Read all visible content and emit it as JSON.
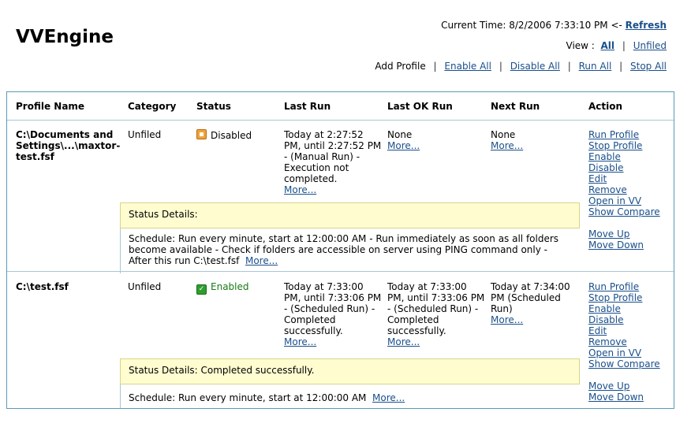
{
  "app": {
    "title": "VVEngine"
  },
  "header": {
    "current_time_label": "Current Time: 8/2/2006 7:33:10 PM <-",
    "refresh": "Refresh",
    "view_label": "View :",
    "view_all": "All",
    "view_unfiled": "Unfiled",
    "actions": {
      "add_profile": "Add Profile",
      "enable_all": "Enable All",
      "disable_all": "Disable All",
      "run_all": "Run All",
      "stop_all": "Stop All"
    }
  },
  "table": {
    "columns": {
      "profile_name": "Profile Name",
      "category": "Category",
      "status": "Status",
      "last_run": "Last Run",
      "last_ok_run": "Last OK Run",
      "next_run": "Next Run",
      "action": "Action"
    },
    "action_links": {
      "run": "Run Profile",
      "stop": "Stop Profile",
      "enable": "Enable",
      "disable": "Disable",
      "edit": "Edit",
      "remove": "Remove",
      "open": "Open in VV",
      "compare": "Show Compare",
      "move_up": "Move Up",
      "move_down": "Move Down"
    },
    "more": "More...",
    "rows": [
      {
        "profile_name": "C:\\Documents and Settings\\...\\maxtor-test.fsf",
        "category": "Unfiled",
        "status": "Disabled",
        "last_run": "Today at 2:27:52 PM, until 2:27:52 PM - (Manual Run) - Execution not completed.",
        "last_ok_run": "None",
        "next_run": "None",
        "status_details": "Status Details:",
        "schedule": "Schedule: Run every minute, start at 12:00:00 AM - Run immediately as soon as all folders become available - Check if folders are accessible on server using PING command only - After this run C:\\test.fsf"
      },
      {
        "profile_name": "C:\\test.fsf",
        "category": "Unfiled",
        "status": "Enabled",
        "last_run": "Today at 7:33:00 PM, until 7:33:06 PM - (Scheduled Run) - Completed successfully.",
        "last_ok_run": "Today at 7:33:00 PM, until 7:33:06 PM - (Scheduled Run) - Completed successfully.",
        "next_run": "Today at 7:34:00 PM (Scheduled Run)",
        "status_details": "Status Details: Completed successfully.",
        "schedule": "Schedule: Run every minute, start at 12:00:00 AM"
      }
    ]
  }
}
